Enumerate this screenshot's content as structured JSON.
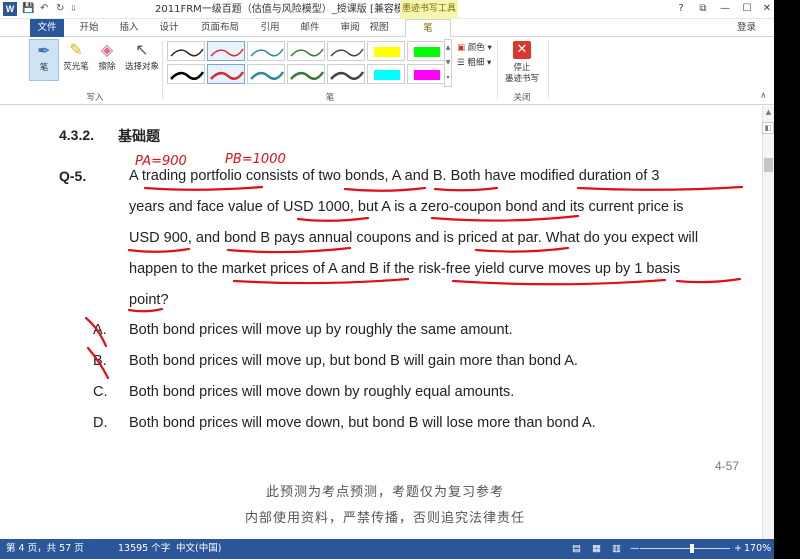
{
  "window": {
    "title": "2011FRM一级百题（估值与风险模型）_授课版 [兼容模式] - Word",
    "context_tab_group": "墨迹书写工具",
    "logo_letter": "W",
    "controls": [
      "?",
      "⧉",
      "—",
      "☐",
      "✕"
    ]
  },
  "quick_access": {
    "save": "💾",
    "undo": "↶",
    "redo": "↻",
    "more": "⇩"
  },
  "tabs": [
    {
      "label": "文件"
    },
    {
      "label": "开始"
    },
    {
      "label": "插入"
    },
    {
      "label": "设计"
    },
    {
      "label": "页面布局"
    },
    {
      "label": "引用"
    },
    {
      "label": "邮件"
    },
    {
      "label": "审阅"
    },
    {
      "label": "视图"
    },
    {
      "label": "笔"
    }
  ],
  "account": {
    "login": "登录"
  },
  "ribbon": {
    "write_group": {
      "label": "写入",
      "pen": "笔",
      "highlighter": "荧光笔",
      "eraser": "擦除",
      "select": "选择对象"
    },
    "pens_group": {
      "label": "笔",
      "pen_colors": [
        "#2a2a2a",
        "#d03030",
        "#2c8c9a",
        "#3a7a3a",
        "#444444",
        "#ffff00",
        "#00ff00",
        "#000000",
        "#d03030",
        "#2c8c9a",
        "#3a7a3a",
        "#444444",
        "#00ffff",
        "#ff00ff"
      ],
      "color_option": "颜色",
      "thickness_option": "粗细"
    },
    "close_group": {
      "label": "关闭",
      "stop_line1": "停止",
      "stop_line2": "墨迹书写"
    }
  },
  "document": {
    "section_number": "4.3.2.",
    "section_title": "基础题",
    "question_number": "Q-5.",
    "question_lines": [
      "A trading portfolio consists of two bonds, A and B. Both have modified duration of 3",
      "years and face value of USD 1000, but A is a zero-coupon bond and its current price is",
      "USD 900, and bond B pays annual coupons and is priced at par. What do you expect will",
      "happen to the market prices of A and B if the risk-free yield curve moves up by 1 basis",
      "point?"
    ],
    "options": [
      {
        "letter": "A.",
        "text": "Both bond prices will move up by roughly the same amount."
      },
      {
        "letter": "B.",
        "text": "Both bond prices will move up, but bond B will gain more than bond A."
      },
      {
        "letter": "C.",
        "text": "Both bond prices will move down by roughly equal amounts."
      },
      {
        "letter": "D.",
        "text": "Both bond prices will move down, but bond B will lose more than bond A."
      }
    ],
    "page_label": "4-57",
    "footer_line1": "此预测为考点预测，考题仅为复习参考",
    "footer_line2": "内部使用资料，严禁传播，否则追究法律责任",
    "ink_notes": [
      "PA=900",
      "PB=1000"
    ],
    "ink_color": "#e0101a"
  },
  "status_bar": {
    "page": "第 4 页，共 57 页",
    "words": "13595 个字",
    "language": "中文(中国)",
    "zoom": "170%",
    "zoom_minus": "—",
    "zoom_plus": "+"
  }
}
